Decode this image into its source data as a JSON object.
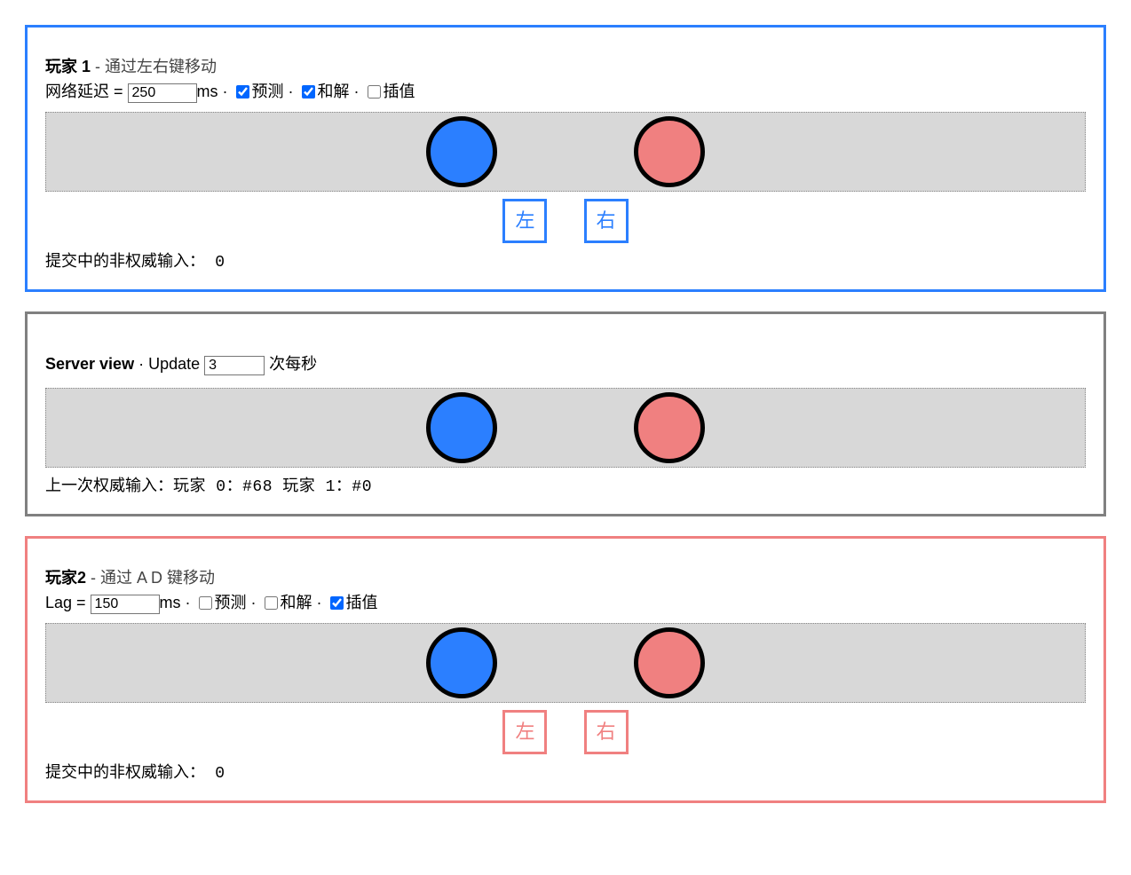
{
  "player1": {
    "title": "玩家 1",
    "subtitle": " - 通过左右键移动",
    "lagLabel": "网络延迟 = ",
    "lagValue": "250",
    "lagUnit": "ms",
    "dot": " · ",
    "predictLabel": "预测",
    "predictChecked": true,
    "reconcileLabel": "和解",
    "reconcileChecked": true,
    "interpLabel": "插值",
    "interpChecked": false,
    "leftBtn": "左",
    "rightBtn": "右",
    "statusLabel": "提交中的非权威输入：",
    "statusValue": " 0",
    "ballBlueX": 40,
    "ballPinkX": 60
  },
  "server": {
    "title": "Server view",
    "dot": " · ",
    "updateLabel": "Update ",
    "updateValue": "3",
    "updateUnit": " 次每秒",
    "statusPrefix": "上一次权威输入：",
    "statusText": "玩家 0：#68 玩家 1：#0",
    "ballBlueX": 40,
    "ballPinkX": 60
  },
  "player2": {
    "title": "玩家2",
    "subtitle": " - 通过 A D 键移动",
    "lagLabel": "Lag = ",
    "lagValue": "150",
    "lagUnit": "ms",
    "dot": " · ",
    "predictLabel": "预测",
    "predictChecked": false,
    "reconcileLabel": "和解",
    "reconcileChecked": false,
    "interpLabel": "插值",
    "interpChecked": true,
    "leftBtn": "左",
    "rightBtn": "右",
    "statusLabel": "提交中的非权威输入：",
    "statusValue": " 0",
    "ballBlueX": 40,
    "ballPinkX": 60
  }
}
